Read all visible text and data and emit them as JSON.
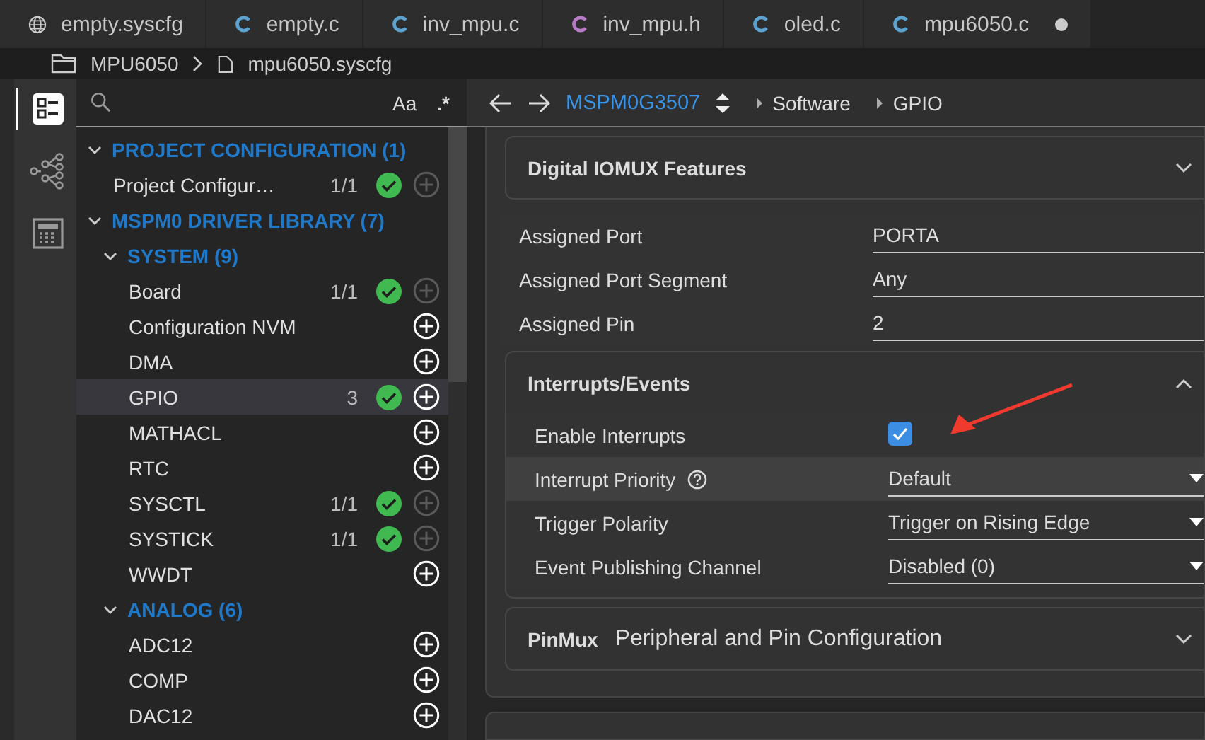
{
  "tabs": [
    {
      "label": "empty.syscfg",
      "kind": "config",
      "modified": false
    },
    {
      "label": "empty.c",
      "kind": "c",
      "modified": false
    },
    {
      "label": "inv_mpu.c",
      "kind": "c",
      "modified": false
    },
    {
      "label": "inv_mpu.h",
      "kind": "h",
      "modified": false
    },
    {
      "label": "oled.c",
      "kind": "c",
      "modified": false
    },
    {
      "label": "mpu6050.c",
      "kind": "c",
      "modified": true
    }
  ],
  "breadcrumb": {
    "folder": "MPU6050",
    "file": "mpu6050.syscfg"
  },
  "activity_bar": [
    {
      "kind": "list",
      "selected": true
    },
    {
      "kind": "tree",
      "selected": false
    },
    {
      "kind": "calculator",
      "selected": false
    }
  ],
  "sidebar": {
    "search": {
      "case_label": "Aa",
      "regex_label": ".*"
    },
    "tree": [
      {
        "label": "PROJECT CONFIGURATION (1)",
        "expanded": true,
        "children": [
          {
            "label": "Project Configur…",
            "count": "1/1",
            "configured": true,
            "add_enabled": false,
            "selected": false
          }
        ]
      },
      {
        "label": "MSPM0 DRIVER LIBRARY (7)",
        "expanded": true,
        "children": [
          {
            "label": "SYSTEM (9)",
            "expanded": true,
            "children": [
              {
                "label": "Board",
                "count": "1/1",
                "configured": true,
                "add_enabled": false,
                "selected": false
              },
              {
                "label": "Configuration NVM",
                "configured": false,
                "add_enabled": true,
                "selected": false
              },
              {
                "label": "DMA",
                "configured": false,
                "add_enabled": true,
                "selected": false
              },
              {
                "label": "GPIO",
                "count": "3",
                "configured": true,
                "add_enabled": true,
                "selected": true
              },
              {
                "label": "MATHACL",
                "configured": false,
                "add_enabled": true,
                "selected": false
              },
              {
                "label": "RTC",
                "configured": false,
                "add_enabled": true,
                "selected": false
              },
              {
                "label": "SYSCTL",
                "count": "1/1",
                "configured": true,
                "add_enabled": false,
                "selected": false
              },
              {
                "label": "SYSTICK",
                "count": "1/1",
                "configured": true,
                "add_enabled": false,
                "selected": false
              },
              {
                "label": "WWDT",
                "configured": false,
                "add_enabled": true,
                "selected": false
              }
            ]
          },
          {
            "label": "ANALOG (6)",
            "expanded": true,
            "children": [
              {
                "label": "ADC12",
                "configured": false,
                "add_enabled": true,
                "selected": false
              },
              {
                "label": "COMP",
                "configured": false,
                "add_enabled": true,
                "selected": false
              },
              {
                "label": "DAC12",
                "configured": false,
                "add_enabled": true,
                "selected": false
              }
            ]
          }
        ]
      }
    ]
  },
  "toolbar": {
    "device": "MSPM0G3507",
    "crumbs": [
      "Software",
      "GPIO"
    ]
  },
  "sections": [
    {
      "kind": "card",
      "title": "Digital IOMUX Features",
      "expanded": false
    },
    {
      "kind": "fields",
      "rows": [
        {
          "kind": "text",
          "label": "Assigned Port",
          "value": "PORTA",
          "help": false,
          "highlighted": false
        },
        {
          "kind": "text",
          "label": "Assigned Port Segment",
          "value": "Any",
          "help": false,
          "highlighted": false
        },
        {
          "kind": "text",
          "label": "Assigned Pin",
          "value": "2",
          "help": false,
          "highlighted": false
        }
      ]
    },
    {
      "kind": "card",
      "title": "Interrupts/Events",
      "expanded": true,
      "rows": [
        {
          "kind": "checkbox",
          "label": "Enable Interrupts",
          "checked": true,
          "help": false,
          "highlighted": false
        },
        {
          "kind": "select",
          "label": "Interrupt Priority",
          "value": "Default",
          "help": true,
          "highlighted": true
        },
        {
          "kind": "select",
          "label": "Trigger Polarity",
          "value": "Trigger on Rising Edge",
          "help": false,
          "highlighted": false
        },
        {
          "kind": "select",
          "label": "Event Publishing Channel",
          "value": "Disabled (0)",
          "help": false,
          "highlighted": false
        }
      ]
    },
    {
      "kind": "card",
      "tag": "PinMux",
      "title": "Peripheral and Pin Configuration",
      "expanded": false
    }
  ]
}
